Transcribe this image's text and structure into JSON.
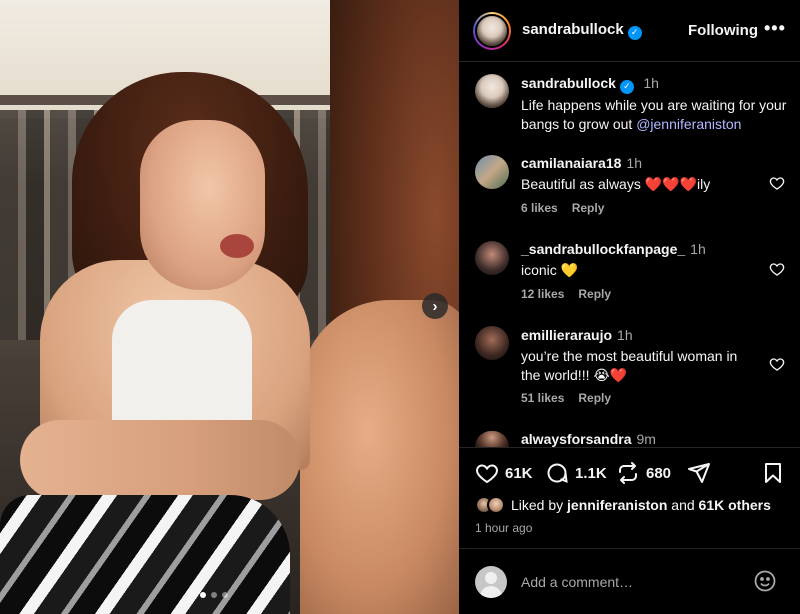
{
  "post": {
    "author": "sandrabullock",
    "follow_status": "Following",
    "more_label": "•••",
    "caption_author": "sandrabullock",
    "caption_time": "1h",
    "caption_text": "Life happens while you are waiting for your bangs to grow out ",
    "caption_mention": "@jenniferaniston",
    "carousel": {
      "next_label": "›",
      "slide_count": 3,
      "active_slide": 1
    }
  },
  "comments": [
    {
      "user": "camilanaiara18",
      "time": "1h",
      "text": "Beautiful as always ❤️❤️❤️ily",
      "likes": "6 likes",
      "reply": "Reply"
    },
    {
      "user": "_sandrabullockfanpage_",
      "time": "1h",
      "text": "iconic 💛",
      "likes": "12 likes",
      "reply": "Reply"
    },
    {
      "user": "emillieraraujo",
      "time": "1h",
      "text_line1": "you’re the most beautiful woman in",
      "text_line2": "the world!!! 😭❤️",
      "likes": "51 likes",
      "reply": "Reply"
    },
    {
      "user": "alwaysforsandra",
      "time": "9m"
    }
  ],
  "actions": {
    "like_count": "61K",
    "comment_count": "1.1K",
    "repost_count": "680"
  },
  "likes_line": {
    "prefix": "Liked by ",
    "user": "jenniferaniston",
    "middle": " and ",
    "others": "61K others"
  },
  "posted_ago": "1 hour ago",
  "comment_box": {
    "placeholder": "Add a comment…"
  },
  "colors": {
    "verified": "#0095f6",
    "mention": "#b1b8ff",
    "background": "#000000"
  }
}
